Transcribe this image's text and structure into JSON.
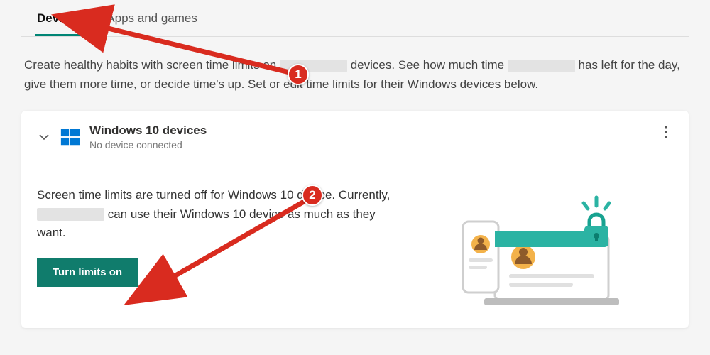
{
  "tabs": {
    "devices": "Devices",
    "apps": "Apps and games"
  },
  "intro": {
    "part1": "Create healthy habits with screen time limits on ",
    "part2": " devices. See how much time ",
    "part3": " has left for the day, give them more time, or decide time's up. Set or edit time limits for their Windows devices below."
  },
  "card": {
    "title": "Windows 10 devices",
    "subtitle": "No device connected",
    "body1": "Screen time limits are turned off for Windows 10 device. Currently, ",
    "body2": " can use their Windows 10 device as much as they want.",
    "button": "Turn limits on"
  },
  "annotations": {
    "step1": "1",
    "step2": "2"
  },
  "colors": {
    "accent": "#008575",
    "button": "#107c6c",
    "annotation": "#d92b1f",
    "winblue": "#0078d4"
  }
}
